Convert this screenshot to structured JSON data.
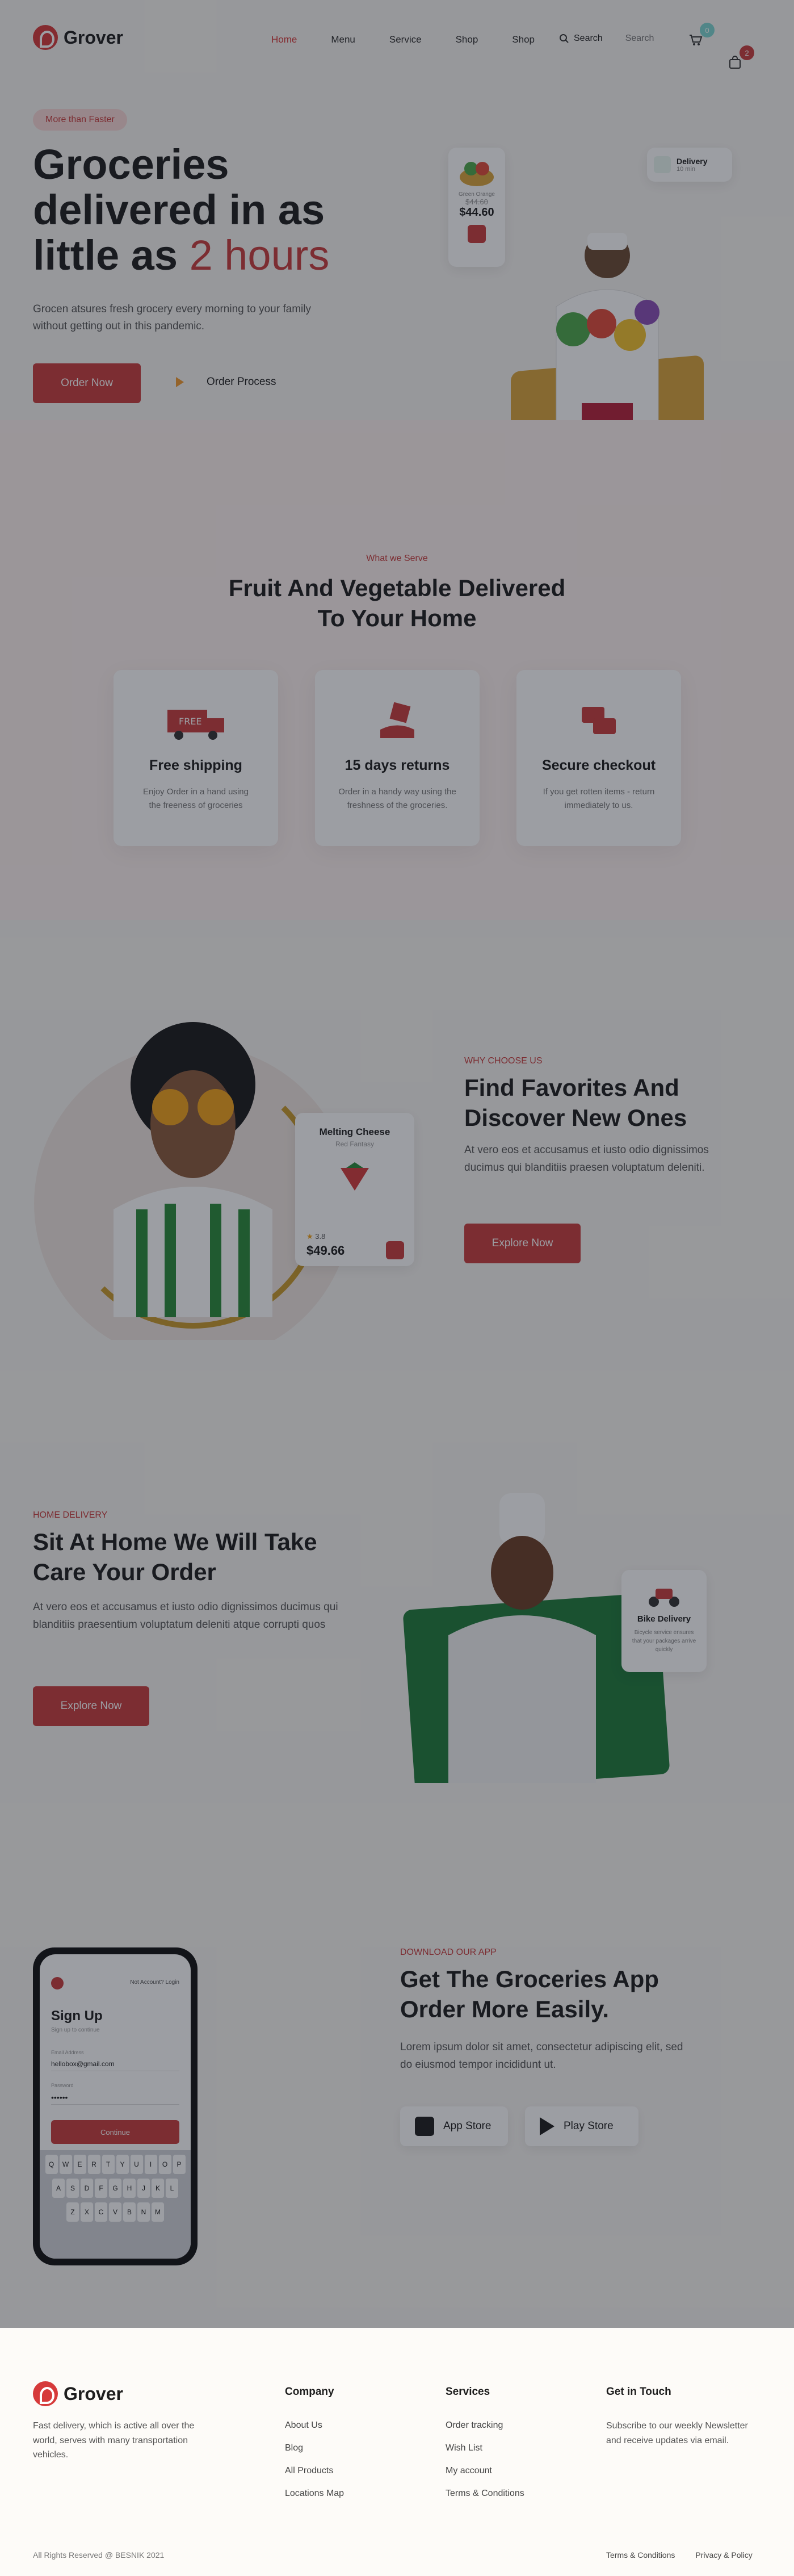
{
  "header": {
    "brand": "Grover",
    "nav": [
      "Home",
      "Menu",
      "Service",
      "Shop",
      "Shop"
    ],
    "search_label": "Search",
    "search_placeholder": "Search",
    "cart_count": "0",
    "bag_count": "2"
  },
  "hero": {
    "pill": "More than Faster",
    "title_line1": "Groceries",
    "title_line2": "delivered in as",
    "title_line3": "little as",
    "title_accent": "2 hours",
    "lead": "Grocen atsures fresh grocery every morning to your family without getting out in this pandemic.",
    "order_btn": "Order Now",
    "process_btn": "Order Process",
    "product_card": {
      "name": "Green Orange",
      "old_price": "$44.60",
      "price": "$44.60"
    },
    "delivery_card": {
      "title": "Delivery",
      "sub": "10 min"
    }
  },
  "serve": {
    "eyebrow": "What we Serve",
    "title_line1": "Fruit And Vegetable Delivered",
    "title_line2": "To Your Home",
    "features": [
      {
        "title": "Free shipping",
        "desc": "Enjoy Order in a hand using the freeness of groceries"
      },
      {
        "title": "15 days returns",
        "desc": "Order in a handy way using the freshness of the groceries."
      },
      {
        "title": "Secure checkout",
        "desc": "If you get rotten items - return immediately to us."
      }
    ],
    "truck_label": "FREE"
  },
  "favorites": {
    "eyebrow": "WHY CHOOSE US",
    "title_line1": "Find Favorites And",
    "title_line2": "Discover New Ones",
    "body": "At vero eos et accusamus et iusto odio dignissimos ducimus qui blanditiis praesen voluptatum deleniti.",
    "btn": "Explore Now",
    "product": {
      "name": "Melting Cheese",
      "sub": "Red Fantasy",
      "rating": "3.8",
      "price": "$49.66"
    }
  },
  "delivery": {
    "eyebrow": "HOME DELIVERY",
    "title_line1": "Sit At Home We Will Take",
    "title_line2": "Care Your Order",
    "body": "At vero eos et accusamus et iusto odio dignissimos ducimus qui blanditiis praesentium voluptatum deleniti atque corrupti quos",
    "btn": "Explore Now",
    "bike_title": "Bike Delivery",
    "bike_desc": "Bicycle service ensures that your packages arrive quickly"
  },
  "app": {
    "eyebrow": "DOWNLOAD OUR APP",
    "title_line1": "Get The Groceries App",
    "title_line2": "Order More Easily.",
    "body": "Lorem ipsum dolor sit amet, consectetur adipiscing elit, sed do eiusmod tempor incididunt ut.",
    "app_store": "App Store",
    "play_store": "Play Store",
    "phone": {
      "top_link": "Not Account? Login",
      "title": "Sign Up",
      "subtitle": "Sign up to continue",
      "email_label": "Email Address",
      "email_value": "hellobox@gmail.com",
      "password_label": "Password",
      "password_value": "••••••",
      "continue": "Continue",
      "keys_row1": [
        "Q",
        "W",
        "E",
        "R",
        "T",
        "Y",
        "U",
        "I",
        "O",
        "P"
      ],
      "keys_row2": [
        "A",
        "S",
        "D",
        "F",
        "G",
        "H",
        "J",
        "K",
        "L"
      ],
      "keys_row3": [
        "Z",
        "X",
        "C",
        "V",
        "B",
        "N",
        "M"
      ]
    }
  },
  "footer": {
    "brand": "Grover",
    "tagline": "Fast delivery, which is active all over the world, serves with many transportation vehicles.",
    "company_title": "Company",
    "company_links": [
      "About Us",
      "Blog",
      "All Products",
      "Locations Map"
    ],
    "services_title": "Services",
    "services_links": [
      "Order tracking",
      "Wish List",
      "My account",
      "Terms & Conditions"
    ],
    "contact_title": "Get in Touch",
    "contact_text": "Subscribe to our weekly Newsletter and receive updates via email.",
    "copyright": "All Rights Reserved @ BESNIK 2021",
    "legal": [
      "Terms & Conditions",
      "Privacy & Policy"
    ]
  },
  "colors": {
    "accent": "#c93d3d",
    "teal": "#7fd6d0",
    "gold": "#d9a43b",
    "green": "#2a8a3a"
  }
}
